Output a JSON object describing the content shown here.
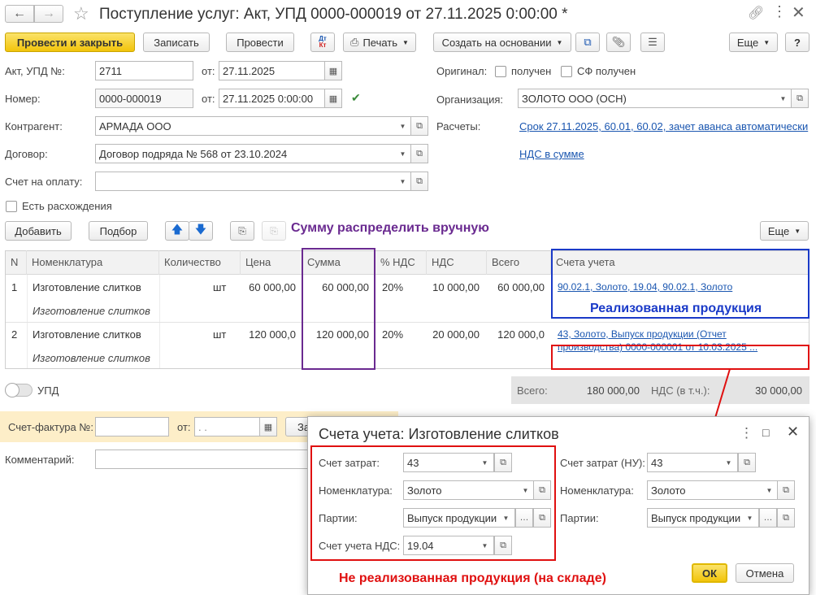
{
  "window": {
    "title": "Поступление услуг: Акт, УПД 0000-000019 от 27.11.2025 0:00:00 *"
  },
  "toolbar": {
    "post_close": "Провести и закрыть",
    "write": "Записать",
    "post": "Провести",
    "dtkt_top": "Дт",
    "dtkt_bottom": "Кт",
    "print": "Печать",
    "create_based": "Создать на основании",
    "more": "Еще",
    "help": "?"
  },
  "form": {
    "act_label": "Акт, УПД №:",
    "act_value": "2711",
    "from_label": "от:",
    "act_date": "27.11.2025",
    "number_label": "Номер:",
    "number_value": "0000-000019",
    "number_date": "27.11.2025  0:00:00",
    "contractor_label": "Контрагент:",
    "contractor_value": "АРМАДА ООО",
    "contract_label": "Договор:",
    "contract_value": "Договор подряда № 568 от 23.10.2024",
    "invoice_label": "Счет на оплату:",
    "invoice_value": "",
    "discrepancy_label": "Есть расхождения",
    "original_label": "Оригинал:",
    "received_label": "получен",
    "sf_received_label": "СФ получен",
    "org_label": "Организация:",
    "org_value": "ЗОЛОТО ООО (ОСН)",
    "settlements_label": "Расчеты:",
    "settlements_link": "Срок 27.11.2025, 60.01, 60.02, зачет аванса автоматически",
    "vat_link": "НДС в сумме"
  },
  "table_toolbar": {
    "add": "Добавить",
    "select": "Подбор",
    "more": "Еще"
  },
  "table": {
    "headers": [
      "N",
      "Номенклатура",
      "Количество",
      "Цена",
      "Сумма",
      "% НДС",
      "НДС",
      "Всего",
      "Счета учета"
    ],
    "rows": [
      {
        "n": "1",
        "name": "Изготовление слитков",
        "name_sub": "Изготовление слитков",
        "unit": "шт",
        "price": "60 000,00",
        "sum": "60 000,00",
        "vat_rate": "20%",
        "vat": "10 000,00",
        "total": "60 000,00",
        "accounts": "90.02.1, Золото, 19.04, 90.02.1, Золото"
      },
      {
        "n": "2",
        "name": "Изготовление слитков",
        "name_sub": "Изготовление слитков",
        "unit": "шт",
        "price": "120 000,0",
        "sum": "120 000,00",
        "vat_rate": "20%",
        "vat": "20 000,00",
        "total": "120 000,0",
        "accounts_line1": "43, Золото, Выпуск продукции (Отчет",
        "accounts_line2": "производства) 0000-000001 от 10.03.2025 ..."
      }
    ]
  },
  "annotations": {
    "manual_sum": "Сумму распределить вручную",
    "sold": "Реализованная продукция",
    "not_sold": "Не реализованная продукция (на складе)"
  },
  "footer": {
    "upd_label": "УПД",
    "total_label": "Всего:",
    "total_value": "180 000,00",
    "vat_label": "НДС (в т.ч.):",
    "vat_value": "30 000,00",
    "sf_label": "Счет-фактура №:",
    "sf_from_label": "от:",
    "sf_date_placeholder": " .  .",
    "sf_register_fragment": "За",
    "comment_label": "Комментарий:"
  },
  "dialog": {
    "title": "Счета учета: Изготовление слитков",
    "cost_account_label": "Счет затрат:",
    "cost_account_value": "43",
    "nomenclature_label": "Номенклатура:",
    "nomenclature_value": "Золото",
    "batches_label": "Партии:",
    "batches_value": "Выпуск продукции",
    "vat_account_label": "Счет учета НДС:",
    "vat_account_value": "19.04",
    "cost_account_nu_label": "Счет затрат (НУ):",
    "cost_account_nu_value": "43",
    "nomenclature_nu_label": "Номенклатура:",
    "nomenclature_nu_value": "Золото",
    "batches_nu_label": "Партии:",
    "batches_nu_value": "Выпуск продукции",
    "ok": "ОК",
    "cancel": "Отмена"
  },
  "colors": {
    "accent_yellow": "#f2c40b",
    "link_blue": "#1a56b0",
    "annot_purple": "#6a2a90",
    "annot_blue": "#1a3ac8",
    "annot_red": "#e01010",
    "footer_bg": "#fdeec8",
    "totals_bg": "#e4e4e4"
  }
}
